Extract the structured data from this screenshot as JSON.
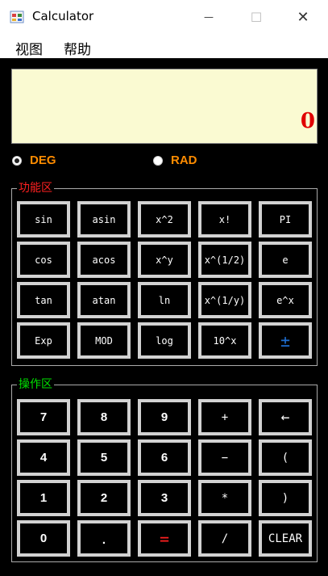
{
  "window": {
    "title": "Calculator",
    "minimize": "—",
    "maximize": "☐",
    "close": "✕"
  },
  "menu": [
    "视图",
    "帮助"
  ],
  "display": {
    "value": "0"
  },
  "angle_mode": {
    "deg": "DEG",
    "rad": "RAD",
    "selected": "DEG"
  },
  "function_area": {
    "label": "功能区",
    "label_color": "#ff2020",
    "buttons": [
      [
        "sin",
        "asin",
        "x^2",
        "x!",
        "PI"
      ],
      [
        "cos",
        "acos",
        "x^y",
        "x^(1/2)",
        "e"
      ],
      [
        "tan",
        "atan",
        "ln",
        "x^(1/y)",
        "e^x"
      ],
      [
        "Exp",
        "MOD",
        "log",
        "10^x",
        "±"
      ]
    ]
  },
  "operation_area": {
    "label": "操作区",
    "label_color": "#00e000",
    "buttons": [
      [
        "7",
        "8",
        "9",
        "+",
        "←"
      ],
      [
        "4",
        "5",
        "6",
        "−",
        "("
      ],
      [
        "1",
        "2",
        "3",
        "*",
        ")"
      ],
      [
        "0",
        ".",
        "=",
        "/",
        "CLEAR"
      ]
    ]
  },
  "colors": {
    "display_bg": "#fafad2",
    "display_text": "#e00000",
    "radio_text": "#ff8c00",
    "plusminus": "#1e6ed2",
    "equals": "#ff2020"
  }
}
